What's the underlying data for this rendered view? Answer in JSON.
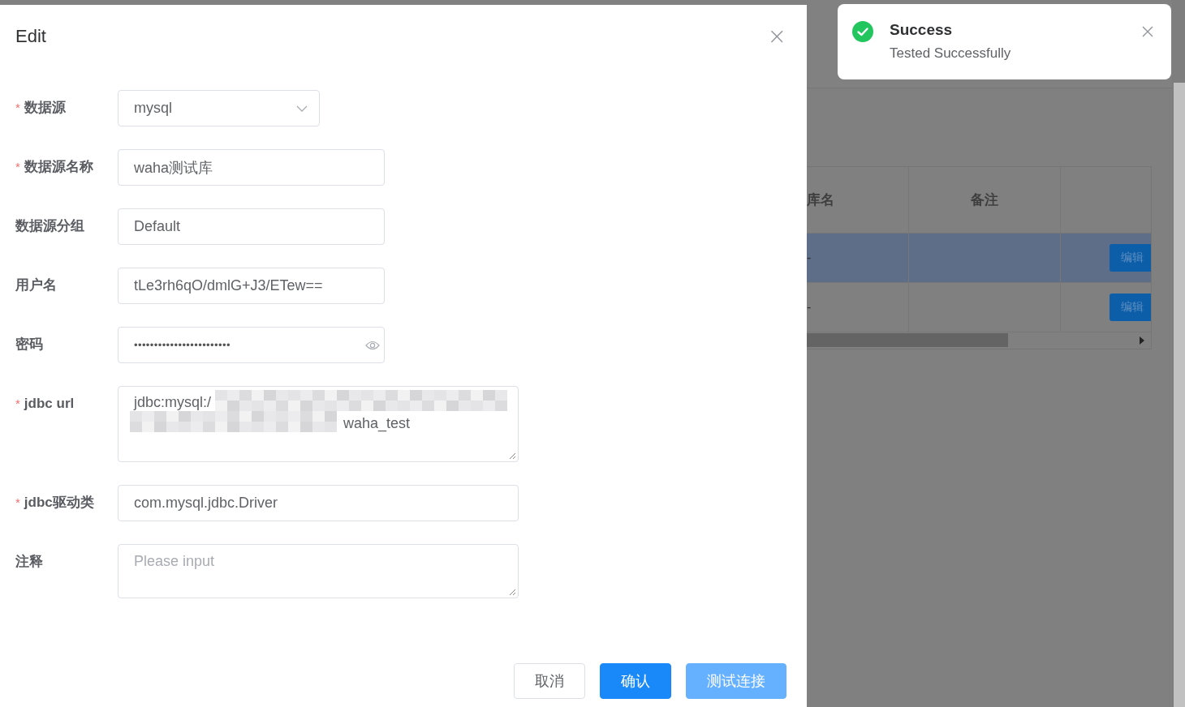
{
  "background_table": {
    "columns": [
      "库名",
      "备注"
    ],
    "rows": [
      {
        "cells": [
          "-"
        ],
        "action": "编辑",
        "highlighted": true
      },
      {
        "cells": [
          "-"
        ],
        "action": "编辑",
        "highlighted": false
      }
    ]
  },
  "dialog": {
    "title": "Edit",
    "close": "×",
    "fields": [
      {
        "kind": "select",
        "label": "数据源",
        "marker": "*",
        "value": "mysql"
      },
      {
        "kind": "input",
        "label": "数据源名称",
        "marker": "*",
        "value": "waha测试库"
      },
      {
        "kind": "input",
        "label": "数据源分组",
        "value": "Default"
      },
      {
        "kind": "input",
        "label": "用户名",
        "value": "tLe3rh6qO/dmlG+J3/ETew=="
      },
      {
        "kind": "password",
        "label": "密码",
        "value": "••••••••••••••••••••••••"
      },
      {
        "kind": "redacted",
        "label": "jdbc url",
        "marker": "*",
        "lines": [
          "jdbc:mysql:/",
          "waha_test"
        ]
      },
      {
        "kind": "wide-input",
        "label": "jdbc驱动类",
        "marker": "*",
        "value": "com.mysql.jdbc.Driver"
      },
      {
        "kind": "textarea",
        "label": "注释",
        "placeholder": "Please input"
      }
    ],
    "buttons": [
      {
        "kind": "default",
        "label": "取消"
      },
      {
        "kind": "primary",
        "label": "确认"
      },
      {
        "kind": "light",
        "label": "测试连接"
      }
    ]
  },
  "toast": {
    "title": "Success",
    "message": "Tested Successfully"
  }
}
